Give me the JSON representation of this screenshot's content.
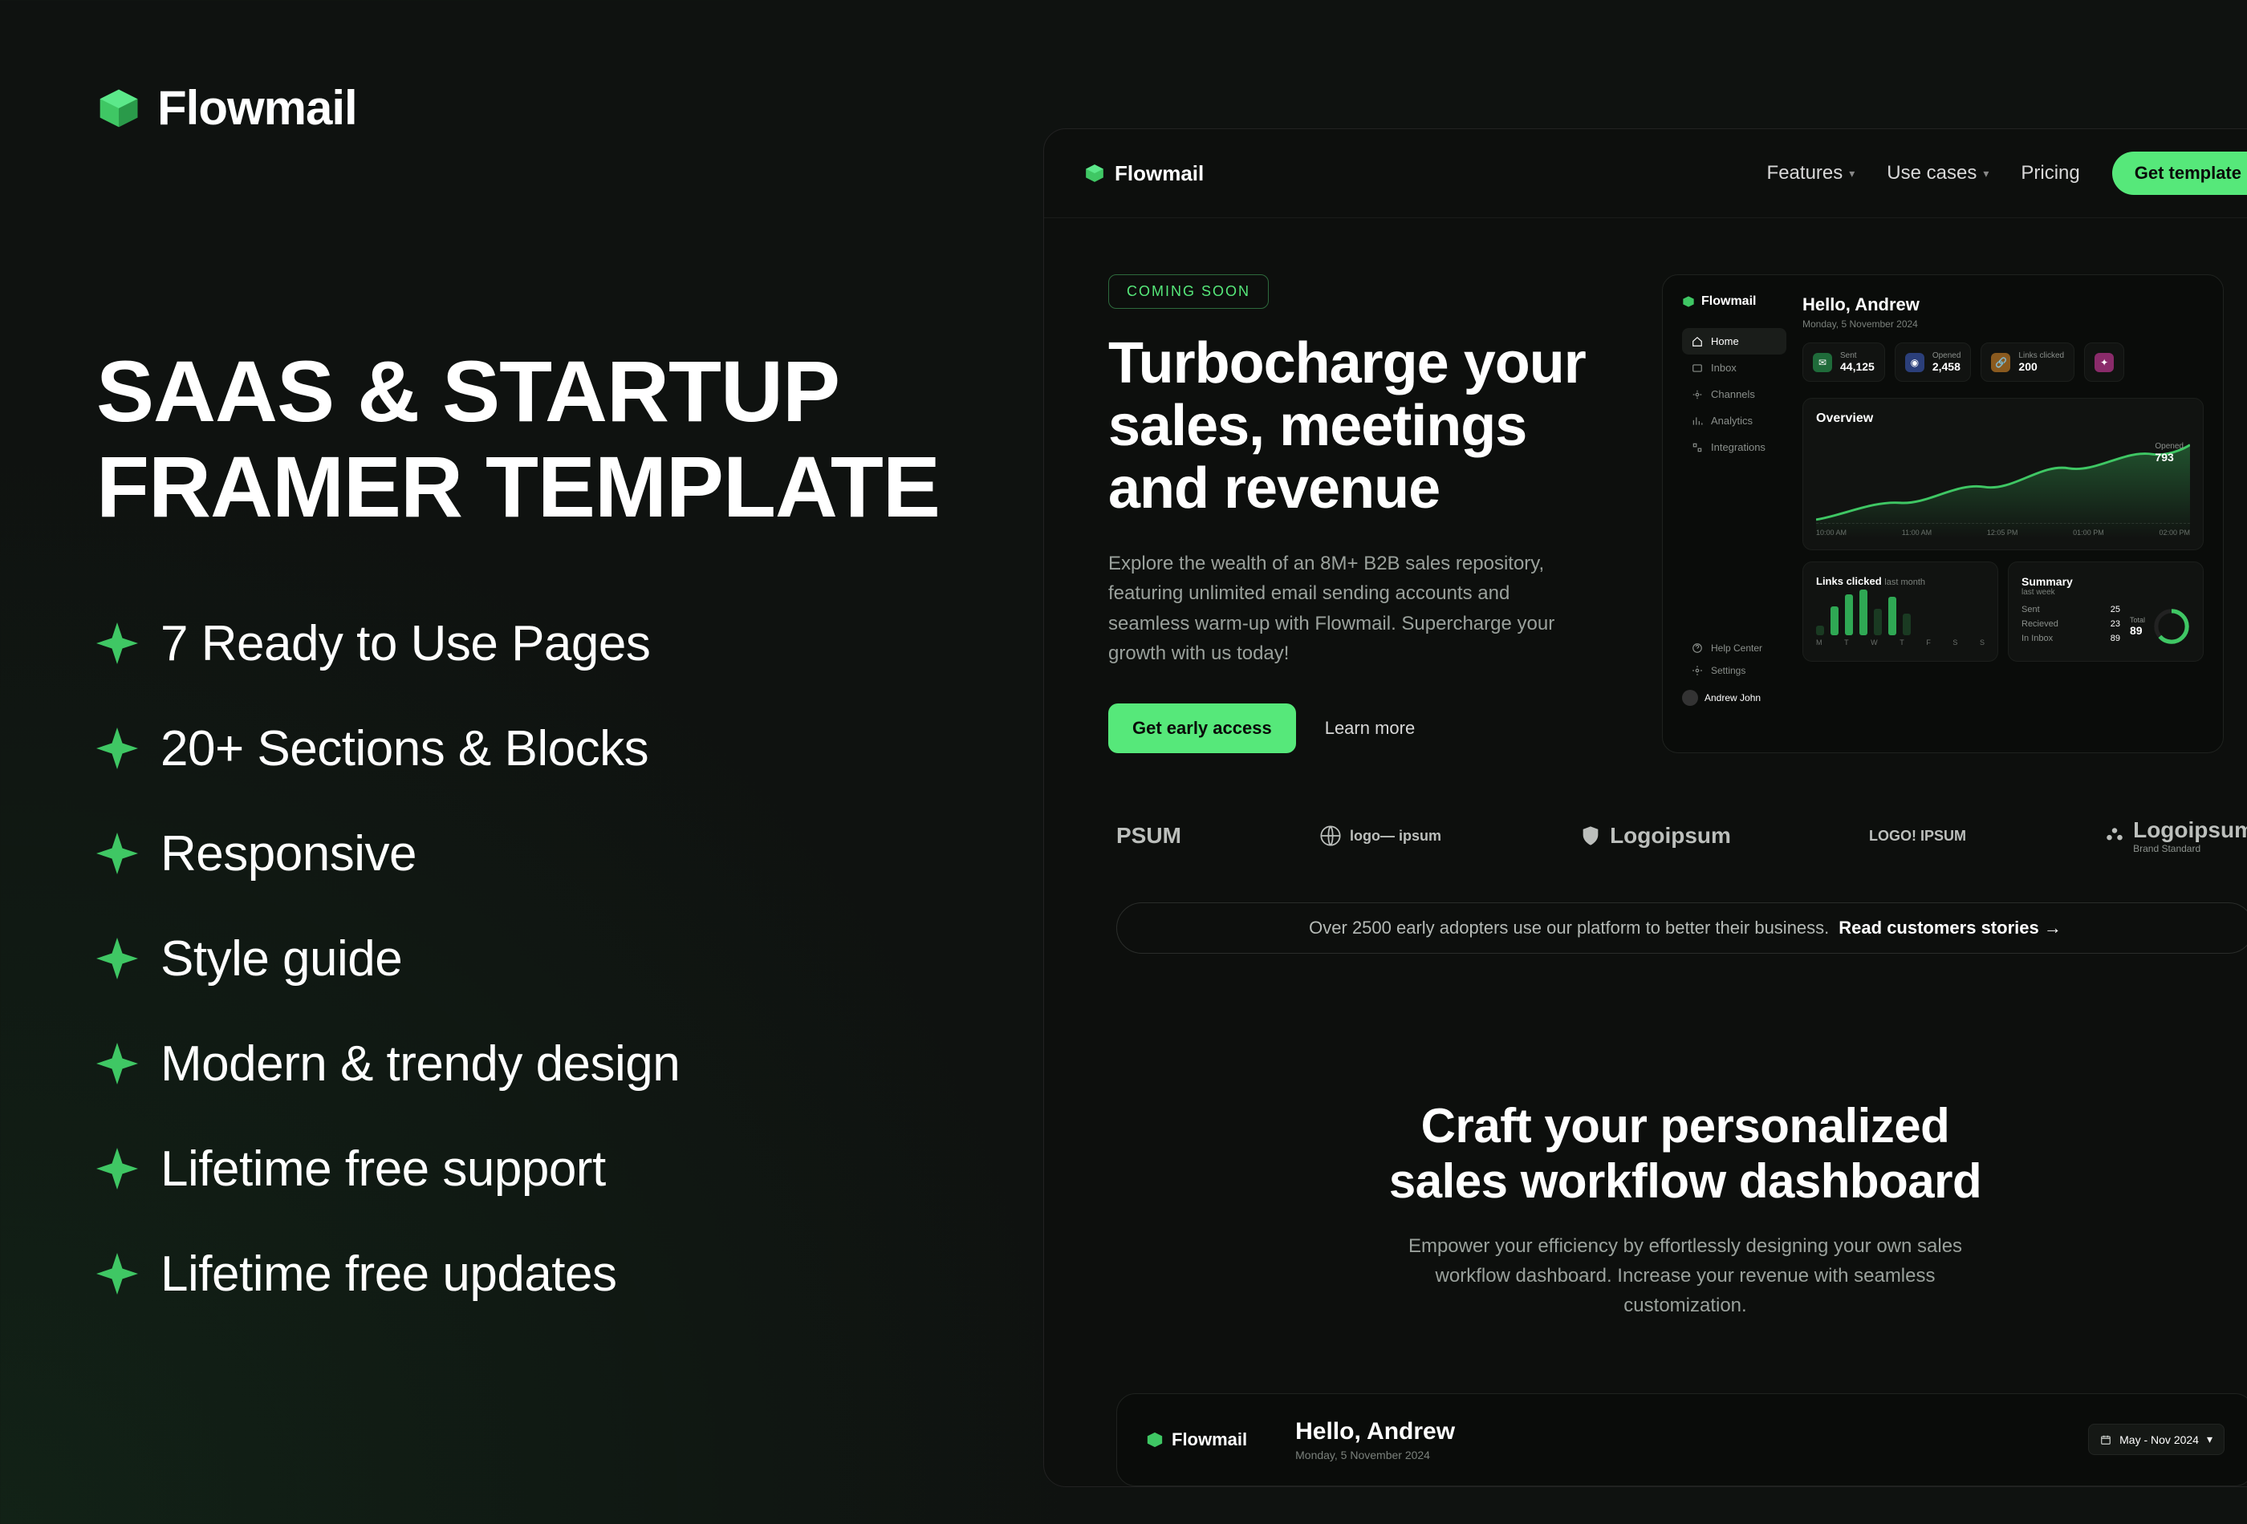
{
  "brand": {
    "name": "Flowmail"
  },
  "left": {
    "title_line1": "SAAS & STARTUP",
    "title_line2": "FRAMER TEMPLATE",
    "bullets": [
      "7 Ready to Use Pages",
      "20+ Sections & Blocks",
      "Responsive",
      "Style guide",
      "Modern & trendy design",
      "Lifetime free support",
      "Lifetime free updates"
    ]
  },
  "nav": {
    "links": [
      "Features",
      "Use cases",
      "Pricing"
    ],
    "cta": "Get template"
  },
  "hero": {
    "pill": "COMING SOON",
    "title": "Turbocharge your sales, meetings and revenue",
    "subtitle": "Explore the wealth of an 8M+ B2B sales repository, featuring unlimited email sending accounts and seamless warm-up with Flowmail. Supercharge your growth with us today!",
    "primary_cta": "Get early access",
    "secondary_cta": "Learn more"
  },
  "dash": {
    "hello": "Hello, Andrew",
    "date": "Monday, 5 November 2024",
    "sidenav": [
      "Home",
      "Inbox",
      "Channels",
      "Analytics",
      "Integrations"
    ],
    "sidefoot": [
      "Help Center",
      "Settings"
    ],
    "user": "Andrew John",
    "stats": [
      {
        "label": "Sent",
        "value": "44,125"
      },
      {
        "label": "Opened",
        "value": "2,458"
      },
      {
        "label": "Links clicked",
        "value": "200"
      },
      {
        "label": "",
        "value": ""
      }
    ],
    "overview_title": "Overview",
    "overview_caption_label": "Opened",
    "overview_caption_value": "793",
    "overview_x": [
      "10:00 AM",
      "11:00 AM",
      "12:05 PM",
      "01:00 PM",
      "02:00 PM"
    ],
    "links_title": "Links clicked",
    "links_title_muted": "last month",
    "links_x": [
      "M",
      "T",
      "W",
      "T",
      "F",
      "S",
      "S"
    ],
    "summary_title": "Summary",
    "summary_sub": "last week",
    "summary_rows": [
      {
        "label": "Sent",
        "value": "25"
      },
      {
        "label": "Recieved",
        "value": "23"
      },
      {
        "label": "In Inbox",
        "value": "89"
      }
    ],
    "ring_label": "Total",
    "ring_value": "89"
  },
  "logos": [
    "PSUM",
    "logo— ipsum",
    "Logoipsum",
    "LOGO! IPSUM",
    "Logoipsum"
  ],
  "logo5_sub": "Brand Standard",
  "adopt": {
    "text": "Over 2500 early adopters use our platform to better their business.",
    "link": "Read customers stories"
  },
  "section2": {
    "title_line1": "Craft your personalized",
    "title_line2": "sales workflow dashboard",
    "subtitle": "Empower your efficiency by effortlessly designing your own sales workflow dashboard. Increase your revenue with seamless customization."
  },
  "dash2": {
    "hello": "Hello, Andrew",
    "date": "Monday, 5 November 2024",
    "range": "May - Nov 2024"
  },
  "chart_data": {
    "overview": {
      "type": "line",
      "title": "Overview",
      "x": [
        "10:00 AM",
        "11:00 AM",
        "12:05 PM",
        "01:00 PM",
        "02:00 PM"
      ],
      "annotation": {
        "label": "Opened",
        "value": 793
      }
    },
    "links_clicked": {
      "type": "bar",
      "title": "Links clicked",
      "subtitle": "last month",
      "categories": [
        "M",
        "T",
        "W",
        "T",
        "F",
        "S",
        "S"
      ],
      "values_relative": [
        20,
        60,
        85,
        95,
        55,
        80,
        45
      ]
    },
    "summary_ring": {
      "type": "pie",
      "title": "Summary",
      "subtitle": "last week",
      "total_label": "Total",
      "total": 89,
      "rows": [
        {
          "label": "Sent",
          "value": 25
        },
        {
          "label": "Recieved",
          "value": 23
        },
        {
          "label": "In Inbox",
          "value": 89
        }
      ]
    }
  }
}
